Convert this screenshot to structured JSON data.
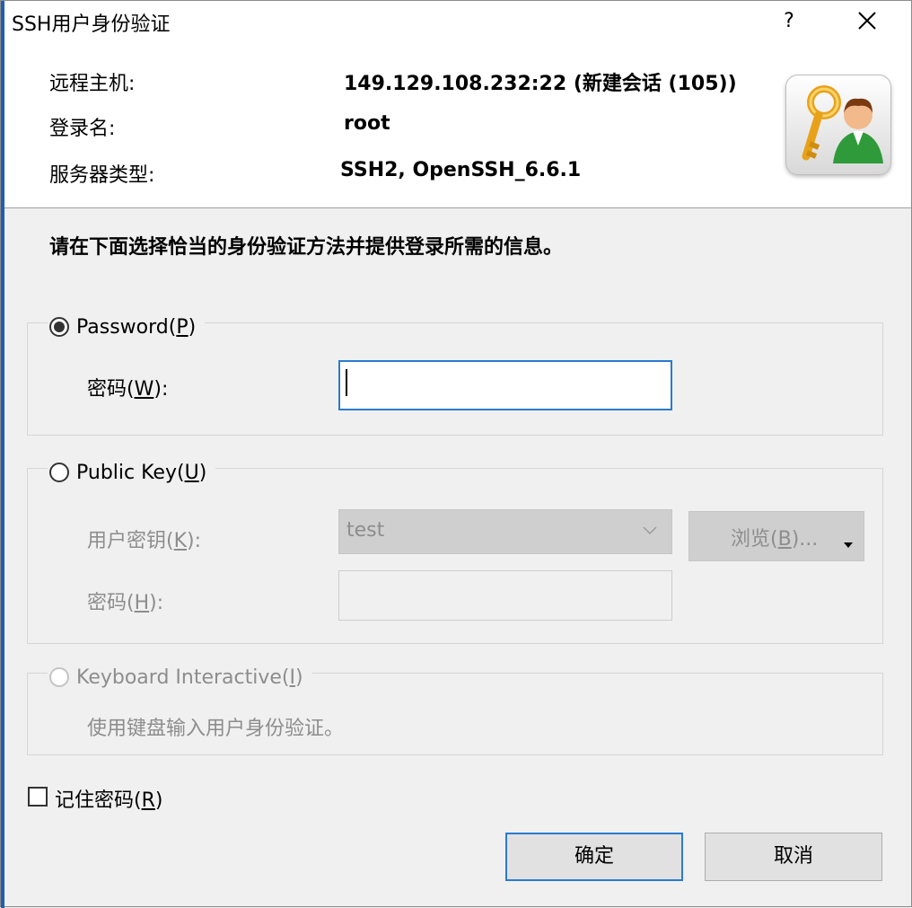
{
  "window": {
    "title": "SSH用户身份验证",
    "help_label": "?"
  },
  "info": {
    "host_label": "远程主机:",
    "host_value": "149.129.108.232:22 (新建会话 (105))",
    "login_label": "登录名:",
    "login_value": "root",
    "server_type_label": "服务器类型:",
    "server_type_value": "SSH2, OpenSSH_6.6.1"
  },
  "instruction": "请在下面选择恰当的身份验证方法并提供登录所需的信息。",
  "password_group": {
    "radio_label": "Password(",
    "radio_mnemonic": "P",
    "radio_end": ")",
    "selected": true,
    "field_label": "密码(",
    "field_mnemonic": "W",
    "field_end": "):",
    "field_value": ""
  },
  "publickey_group": {
    "radio_label": "Public Key(",
    "radio_mnemonic": "U",
    "radio_end": ")",
    "selected": false,
    "key_label": "用户密钥(",
    "key_mnemonic": "K",
    "key_end": "):",
    "key_selected": "test",
    "browse_label": "浏览(",
    "browse_mnemonic": "B",
    "browse_end": ")...",
    "passphrase_label": "密码(",
    "passphrase_mnemonic": "H",
    "passphrase_end": "):",
    "passphrase_value": ""
  },
  "keyboard_group": {
    "radio_label": "Keyboard Interactive(",
    "radio_mnemonic": "I",
    "radio_end": ")",
    "selected": false,
    "description": "使用键盘输入用户身份验证。"
  },
  "remember": {
    "label": "记住密码(",
    "mnemonic": "R",
    "end": ")",
    "checked": false
  },
  "buttons": {
    "ok_label": "确定",
    "cancel_label": "取消"
  },
  "colors": {
    "accent_border": "#2a7bd0",
    "window_edge": "#1e5eb4",
    "dialog_bg": "#f0f0f0",
    "disabled_text": "#8d8d8d"
  }
}
